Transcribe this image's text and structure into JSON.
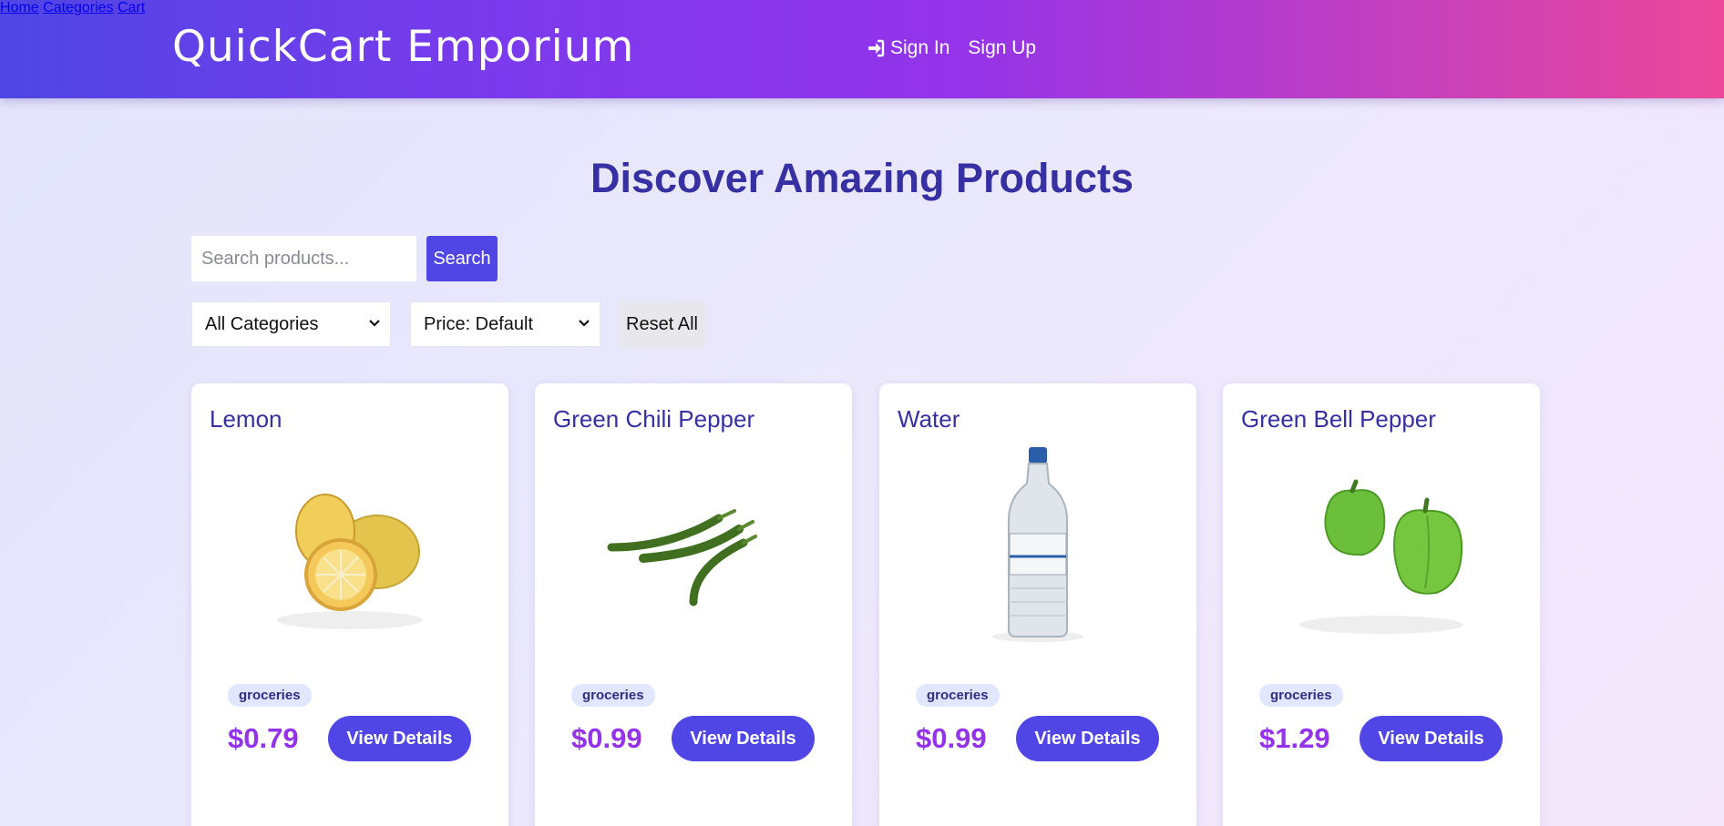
{
  "header": {
    "brand": "QuickCart Emporium",
    "auth": {
      "sign_in": "Sign In",
      "sign_up": "Sign Up",
      "sign_in_icon": "sign-in-icon"
    },
    "nav": [
      "Home",
      "Categories",
      "Cart"
    ]
  },
  "main": {
    "title": "Discover Amazing Products",
    "search": {
      "placeholder": "Search products...",
      "value": "",
      "button": "Search"
    },
    "filters": {
      "category": "All Categories",
      "price": "Price: Default",
      "reset": "Reset All"
    }
  },
  "products": [
    {
      "name": "Lemon",
      "category": "groceries",
      "price": "$0.79",
      "button": "View Details",
      "image": "lemon-image"
    },
    {
      "name": "Green Chili Pepper",
      "category": "groceries",
      "price": "$0.99",
      "button": "View Details",
      "image": "green-chili-image"
    },
    {
      "name": "Water",
      "category": "groceries",
      "price": "$0.99",
      "button": "View Details",
      "image": "water-bottle-image"
    },
    {
      "name": "Green Bell Pepper",
      "category": "groceries",
      "price": "$1.29",
      "button": "View Details",
      "image": "bell-pepper-image"
    }
  ],
  "colors": {
    "accent": "#4f46e5",
    "price": "#9333ea",
    "heading": "#3730a3",
    "tag_bg": "#e0e7ff"
  }
}
